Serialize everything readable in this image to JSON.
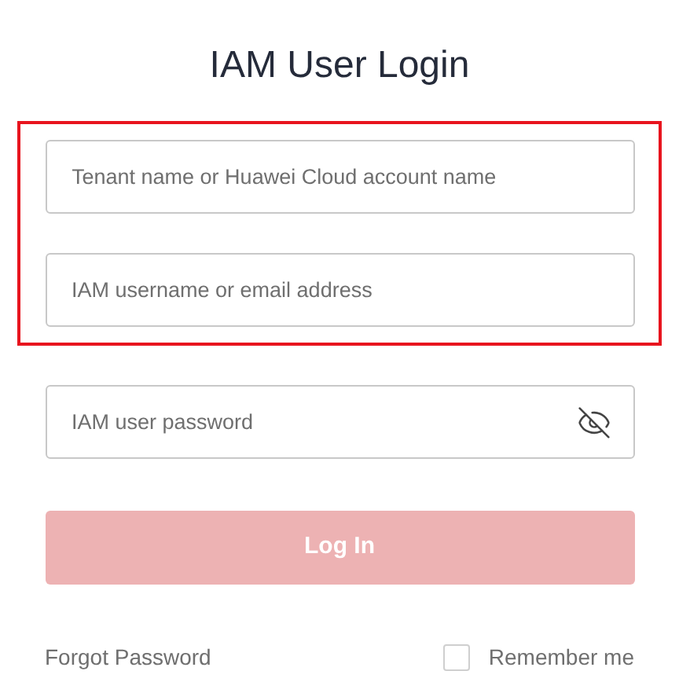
{
  "title": "IAM User Login",
  "highlighted_fields": [
    {
      "placeholder": "Tenant name or Huawei Cloud account name",
      "kind": "text"
    },
    {
      "placeholder": "IAM username or email address",
      "kind": "text"
    }
  ],
  "fields": [
    {
      "placeholder": "IAM user password",
      "kind": "password",
      "password_visible": false
    }
  ],
  "login_button": {
    "label": "Log In",
    "disabled": true
  },
  "forgot_link": "Forgot Password",
  "remember": {
    "label": "Remember me",
    "checked": false
  }
}
